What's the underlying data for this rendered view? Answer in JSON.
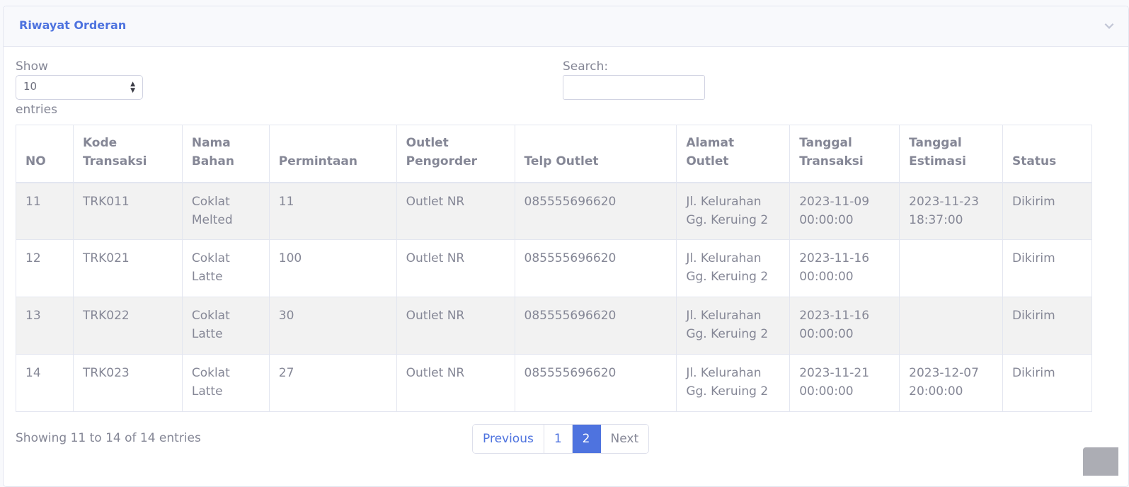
{
  "card": {
    "title": "Riwayat Orderan"
  },
  "length": {
    "show": "Show",
    "value": "10",
    "entries": "entries"
  },
  "search": {
    "label": "Search:",
    "value": ""
  },
  "table": {
    "headers": [
      "NO",
      "Kode Transaksi",
      "Nama Bahan",
      "Permintaan",
      "Outlet Pengorder",
      "Telp Outlet",
      "Alamat Outlet",
      "Tanggal Transaksi",
      "Tanggal Estimasi",
      "Status"
    ],
    "rows": [
      [
        "11",
        "TRK011",
        "Coklat Melted",
        "11",
        "Outlet NR",
        "085555696620",
        "Jl. Kelurahan Gg. Keruing 2",
        "2023-11-09 00:00:00",
        "2023-11-23 18:37:00",
        "Dikirim"
      ],
      [
        "12",
        "TRK021",
        "Coklat Latte",
        "100",
        "Outlet NR",
        "085555696620",
        "Jl. Kelurahan Gg. Keruing 2",
        "2023-11-16 00:00:00",
        "",
        "Dikirim"
      ],
      [
        "13",
        "TRK022",
        "Coklat Latte",
        "30",
        "Outlet NR",
        "085555696620",
        "Jl. Kelurahan Gg. Keruing 2",
        "2023-11-16 00:00:00",
        "",
        "Dikirim"
      ],
      [
        "14",
        "TRK023",
        "Coklat Latte",
        "27",
        "Outlet NR",
        "085555696620",
        "Jl. Kelurahan Gg. Keruing 2",
        "2023-11-21 00:00:00",
        "2023-12-07 20:00:00",
        "Dikirim"
      ]
    ]
  },
  "info": "Showing 11 to 14 of 14 entries",
  "pagination": {
    "previous": "Previous",
    "pages": [
      "1",
      "2"
    ],
    "active": "2",
    "next": "Next"
  },
  "colors": {
    "accent": "#4e73df",
    "text": "#858796",
    "highlight": "#2a62c9"
  },
  "icons": {
    "collapse": "chevron-down-icon",
    "select": "sort-arrows-icon",
    "scroll": "scroll-top-button"
  }
}
